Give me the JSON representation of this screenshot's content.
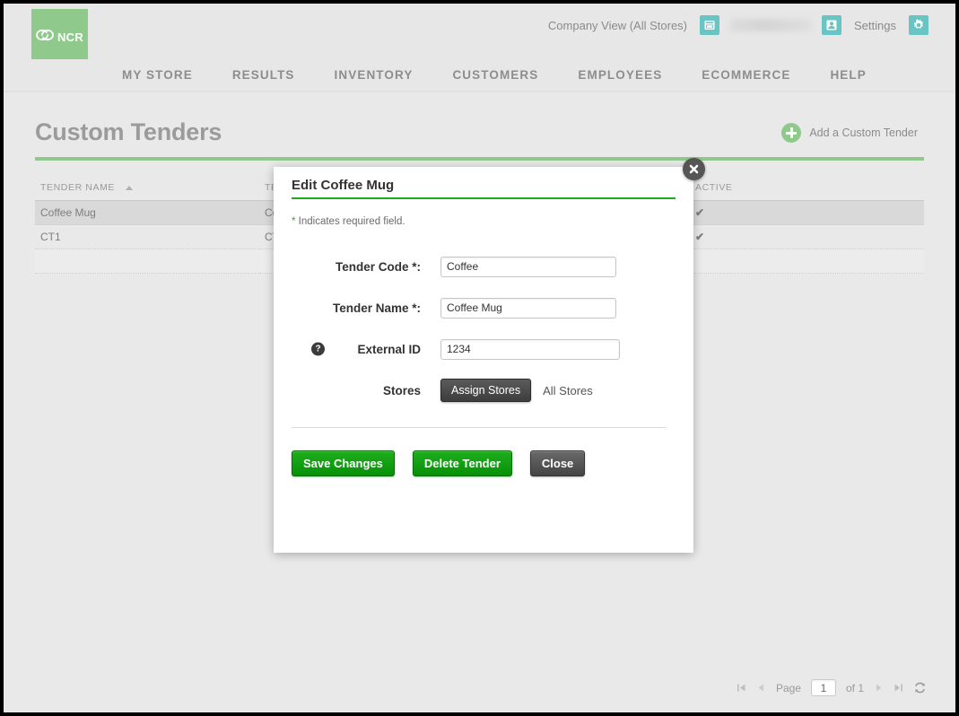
{
  "brand": {
    "logo_text": "NCR",
    "logo_bg": "#8fc98c"
  },
  "header": {
    "company_view": "Company View (All Stores)",
    "store_icon": "store-icon",
    "user_icon": "user-icon",
    "user_name": "",
    "settings_label": "Settings",
    "gear_icon": "gear-icon",
    "icon_color": "#69c4c4"
  },
  "nav": {
    "items": [
      {
        "label": "MY STORE"
      },
      {
        "label": "RESULTS"
      },
      {
        "label": "INVENTORY"
      },
      {
        "label": "CUSTOMERS"
      },
      {
        "label": "EMPLOYEES"
      },
      {
        "label": "ECOMMERCE"
      },
      {
        "label": "HELP"
      }
    ]
  },
  "page": {
    "title": "Custom Tenders",
    "add_label": "Add a Custom Tender",
    "accent_color": "#8fc98c"
  },
  "table": {
    "columns": [
      {
        "label": "TENDER NAME",
        "sorted": true
      },
      {
        "label": "TE"
      },
      {
        "label": "ACTIVE"
      }
    ],
    "rows": [
      {
        "name": "Coffee Mug",
        "code": "Co",
        "active": "✔",
        "selected": true
      },
      {
        "name": "CT1",
        "code": "CT",
        "active": "✔",
        "selected": false
      }
    ]
  },
  "modal": {
    "title": "Edit Coffee Mug",
    "required_star": "*",
    "required_note": " Indicates required field.",
    "close_icon": "close-icon",
    "fields": [
      {
        "label": "Tender Code *:",
        "value": "Coffee",
        "placeholder": ""
      },
      {
        "label": "Tender Name *:",
        "value": "Coffee Mug",
        "placeholder": ""
      },
      {
        "label": "External ID",
        "value": "1234",
        "placeholder": "",
        "help": "?"
      }
    ],
    "stores_label": "Stores",
    "assign_stores_button": "Assign Stores",
    "all_stores_text": "All Stores",
    "buttons": [
      {
        "label": "Save Changes",
        "style": "green"
      },
      {
        "label": "Delete Tender",
        "style": "green"
      },
      {
        "label": "Close",
        "style": "gray"
      }
    ]
  },
  "pager": {
    "first_icon": "first-page-icon",
    "prev_icon": "prev-page-icon",
    "page_label": "Page",
    "page_value": "1",
    "of_label": "of 1",
    "next_icon": "next-page-icon",
    "last_icon": "last-page-icon",
    "refresh_icon": "refresh-icon"
  }
}
